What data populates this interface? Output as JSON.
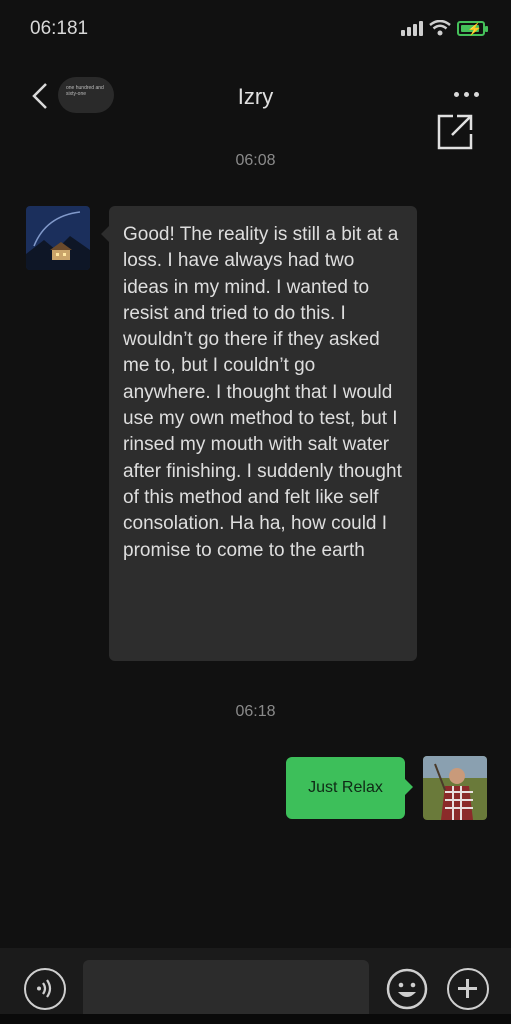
{
  "status_bar": {
    "time": "06:181"
  },
  "nav": {
    "unread_label": "one hundred and sixty-one",
    "title": "Izry"
  },
  "messages": [
    {
      "time": "06:08",
      "direction": "incoming",
      "text": "Good! The reality is still a bit at a loss. I have always had two ideas in my mind. I wanted to resist and tried to do this. I wouldn’t go there if they asked me to, but I couldn’t go anywhere. I thought that I would use my own method to test, but I rinsed my mouth with salt water after finishing. I suddenly thought of this method and felt like self consolation. Ha ha, how could I promise to come to the earth"
    },
    {
      "time": "06:18",
      "direction": "outgoing",
      "text": "Just Relax"
    }
  ],
  "colors": {
    "outgoing_bubble": "#3dbf5a",
    "incoming_bubble": "#2d2d2d",
    "battery": "#45c05a"
  }
}
